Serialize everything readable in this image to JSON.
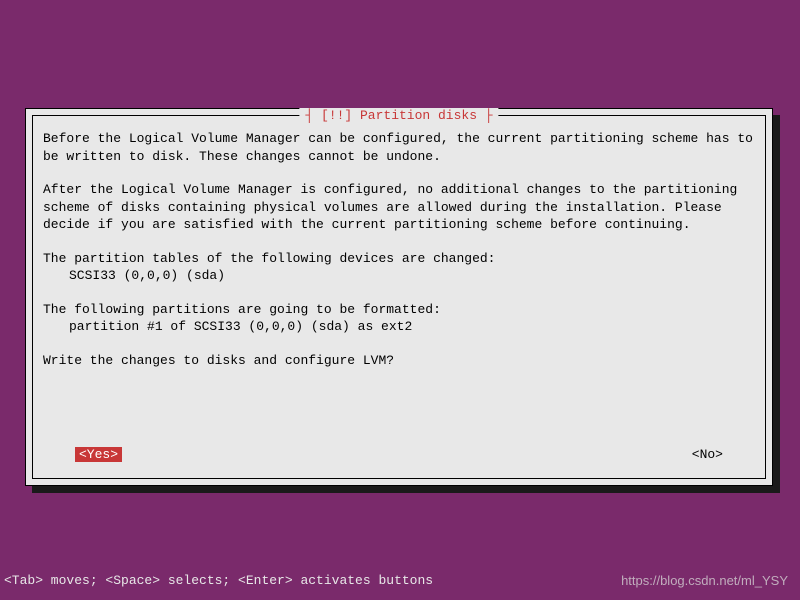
{
  "dialog": {
    "title": "┤ [!!] Partition disks ├",
    "paragraphs": {
      "p1": "Before the Logical Volume Manager can be configured, the current partitioning scheme has to be written to disk. These changes cannot be undone.",
      "p2": "After the Logical Volume Manager is configured, no additional changes to the partitioning scheme of disks containing physical volumes are allowed during the installation. Please decide if you are satisfied with the current partitioning scheme before continuing.",
      "p3": "The partition tables of the following devices are changed:",
      "p3_item": "SCSI33 (0,0,0) (sda)",
      "p4": "The following partitions are going to be formatted:",
      "p4_item": "partition #1 of SCSI33 (0,0,0) (sda) as ext2",
      "p5": "Write the changes to disks and configure LVM?"
    },
    "buttons": {
      "yes": "<Yes>",
      "no": "<No>"
    }
  },
  "footer": {
    "hint": "<Tab> moves; <Space> selects; <Enter> activates buttons",
    "watermark": "https://blog.csdn.net/ml_YSY"
  }
}
